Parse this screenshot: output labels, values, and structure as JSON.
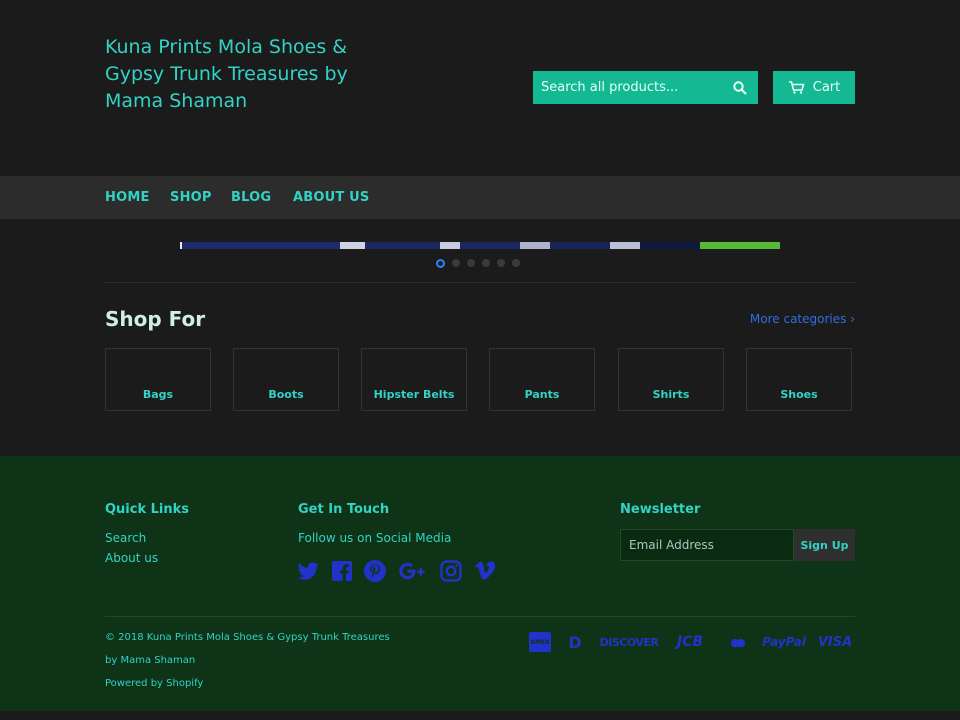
{
  "header": {
    "site_title": "Kuna Prints Mola Shoes & Gypsy Trunk Treasures by Mama Shaman",
    "search_placeholder": "Search all products...",
    "cart_label": "Cart"
  },
  "nav": {
    "items": [
      {
        "label": "HOME"
      },
      {
        "label": "SHOP"
      },
      {
        "label": "BLOG"
      },
      {
        "label": "ABOUT US"
      }
    ]
  },
  "slider": {
    "slide_count": 6,
    "active_index": 0
  },
  "collections": {
    "title": "Shop For",
    "more_link": "More categories ›",
    "items": [
      {
        "label": "Bags"
      },
      {
        "label": "Boots"
      },
      {
        "label": "Hipster Belts"
      },
      {
        "label": "Pants"
      },
      {
        "label": "Shirts"
      },
      {
        "label": "Shoes"
      }
    ]
  },
  "footer": {
    "quick_links": {
      "title": "Quick Links",
      "links": [
        {
          "label": "Search"
        },
        {
          "label": "About us"
        }
      ]
    },
    "get_in_touch": {
      "title": "Get In Touch",
      "text": "Follow us on Social Media",
      "social_icons": [
        "twitter-icon",
        "facebook-icon",
        "pinterest-icon",
        "google-plus-icon",
        "instagram-icon",
        "vimeo-icon"
      ]
    },
    "newsletter": {
      "title": "Newsletter",
      "email_placeholder": "Email Address",
      "signup_label": "Sign Up"
    },
    "copyright_line1": "© 2018 Kuna Prints Mola Shoes & Gypsy Trunk Treasures",
    "copyright_line2": "by Mama Shaman",
    "powered_by": "Powered by Shopify",
    "payment_icons": [
      {
        "name": "american-express-icon",
        "text": "AMEX"
      },
      {
        "name": "diners-club-icon",
        "text": "D"
      },
      {
        "name": "discover-icon",
        "text": "DISCOVER"
      },
      {
        "name": "jcb-icon",
        "text": "JCB"
      },
      {
        "name": "master-icon",
        "text": "●●"
      },
      {
        "name": "paypal-icon",
        "text": "PayPal"
      },
      {
        "name": "visa-icon",
        "text": "VISA"
      }
    ]
  },
  "colors": {
    "accent": "#32d3c5",
    "button": "#14b892",
    "footer_bg": "#0e3317",
    "link_blue": "#2f6fe0"
  }
}
